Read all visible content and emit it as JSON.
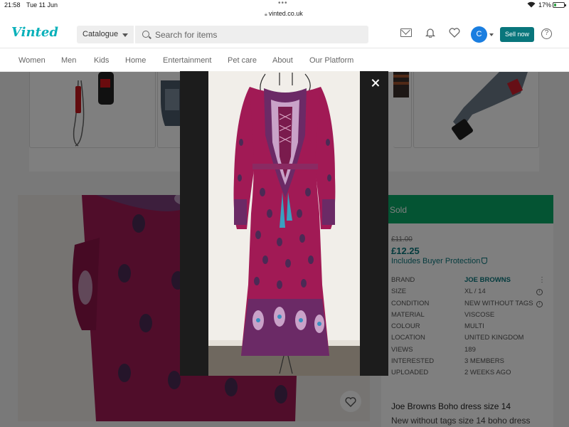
{
  "status_bar": {
    "time": "21:58",
    "date": "Tue 11 Jun",
    "url": "vinted.co.uk",
    "battery_percent": "17%",
    "battery_level": 0.17
  },
  "header": {
    "logo": "Vinted",
    "catalogue_label": "Catalogue",
    "search_placeholder": "Search for items",
    "avatar_initial": "C",
    "sell_label": "Sell now",
    "help_label": "?"
  },
  "nav": {
    "items": [
      {
        "label": "Women"
      },
      {
        "label": "Men"
      },
      {
        "label": "Kids"
      },
      {
        "label": "Home"
      },
      {
        "label": "Entertainment"
      },
      {
        "label": "Pet care"
      },
      {
        "label": "About"
      },
      {
        "label": "Our Platform"
      }
    ]
  },
  "listing": {
    "status": "Sold",
    "old_price": "£11.00",
    "price": "£12.25",
    "buyer_protection": "Includes Buyer Protection",
    "details": [
      {
        "key": "BRAND",
        "value": "JOE BROWNS"
      },
      {
        "key": "SIZE",
        "value": "XL / 14"
      },
      {
        "key": "CONDITION",
        "value": "NEW WITHOUT TAGS"
      },
      {
        "key": "MATERIAL",
        "value": "VISCOSE"
      },
      {
        "key": "COLOUR",
        "value": "MULTI"
      },
      {
        "key": "LOCATION",
        "value": "UNITED KINGDOM"
      },
      {
        "key": "VIEWS",
        "value": "189"
      },
      {
        "key": "INTERESTED",
        "value": "3 MEMBERS"
      },
      {
        "key": "UPLOADED",
        "value": "2 WEEKS AGO"
      }
    ],
    "title": "Joe Browns Boho dress size 14",
    "description": "New without tags size 14 boho dress"
  },
  "colors": {
    "brand": "#09b1ba",
    "sell_button": "#09767c",
    "sold_bar": "#09a866",
    "dress": "#a11a55"
  }
}
